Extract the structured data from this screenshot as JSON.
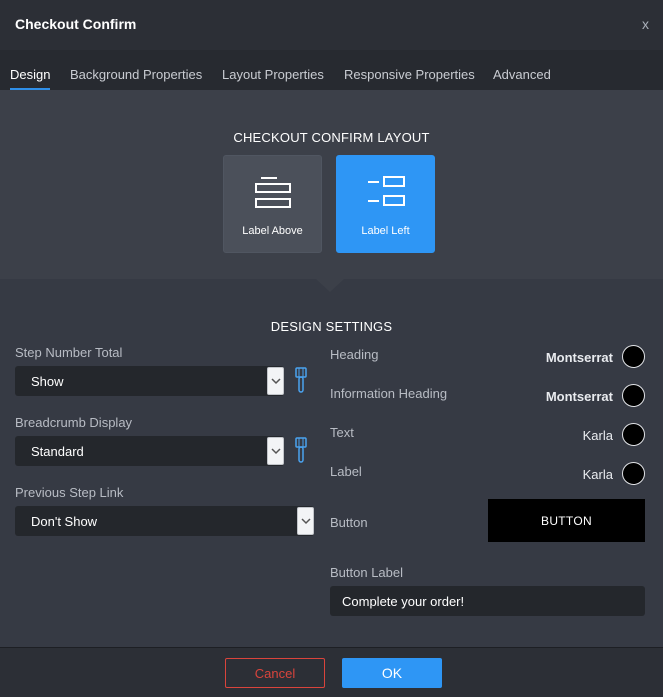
{
  "dialog": {
    "title": "Checkout Confirm",
    "close_label": "x"
  },
  "tabs": [
    {
      "label": "Design",
      "active": true
    },
    {
      "label": "Background Properties"
    },
    {
      "label": "Layout Properties"
    },
    {
      "label": "Responsive Properties"
    },
    {
      "label": "Advanced"
    }
  ],
  "layout": {
    "title": "CHECKOUT CONFIRM LAYOUT",
    "options": [
      {
        "label": "Label Above",
        "icon": "label-above-icon",
        "selected": false
      },
      {
        "label": "Label Left",
        "icon": "label-left-icon",
        "selected": true
      }
    ]
  },
  "design": {
    "title": "DESIGN SETTINGS",
    "step_number_total": {
      "label": "Step Number Total",
      "value": "Show"
    },
    "breadcrumb_display": {
      "label": "Breadcrumb Display",
      "value": "Standard"
    },
    "previous_step_link": {
      "label": "Previous Step Link",
      "value": "Don't Show"
    },
    "typography": [
      {
        "label": "Heading",
        "font": "Montserrat",
        "color": "#000000"
      },
      {
        "label": "Information Heading",
        "font": "Montserrat",
        "color": "#000000"
      },
      {
        "label": "Text",
        "font": "Karla",
        "color": "#000000"
      },
      {
        "label": "Label",
        "font": "Karla",
        "color": "#000000"
      }
    ],
    "button": {
      "label": "Button",
      "preview_text": "BUTTON",
      "color": "#000000"
    },
    "button_label": {
      "label": "Button Label",
      "value": "Complete your order!"
    }
  },
  "footer": {
    "cancel_label": "Cancel",
    "ok_label": "OK"
  },
  "colors": {
    "accent": "#2e96f5",
    "danger": "#d9443c",
    "background": "#363a44"
  }
}
